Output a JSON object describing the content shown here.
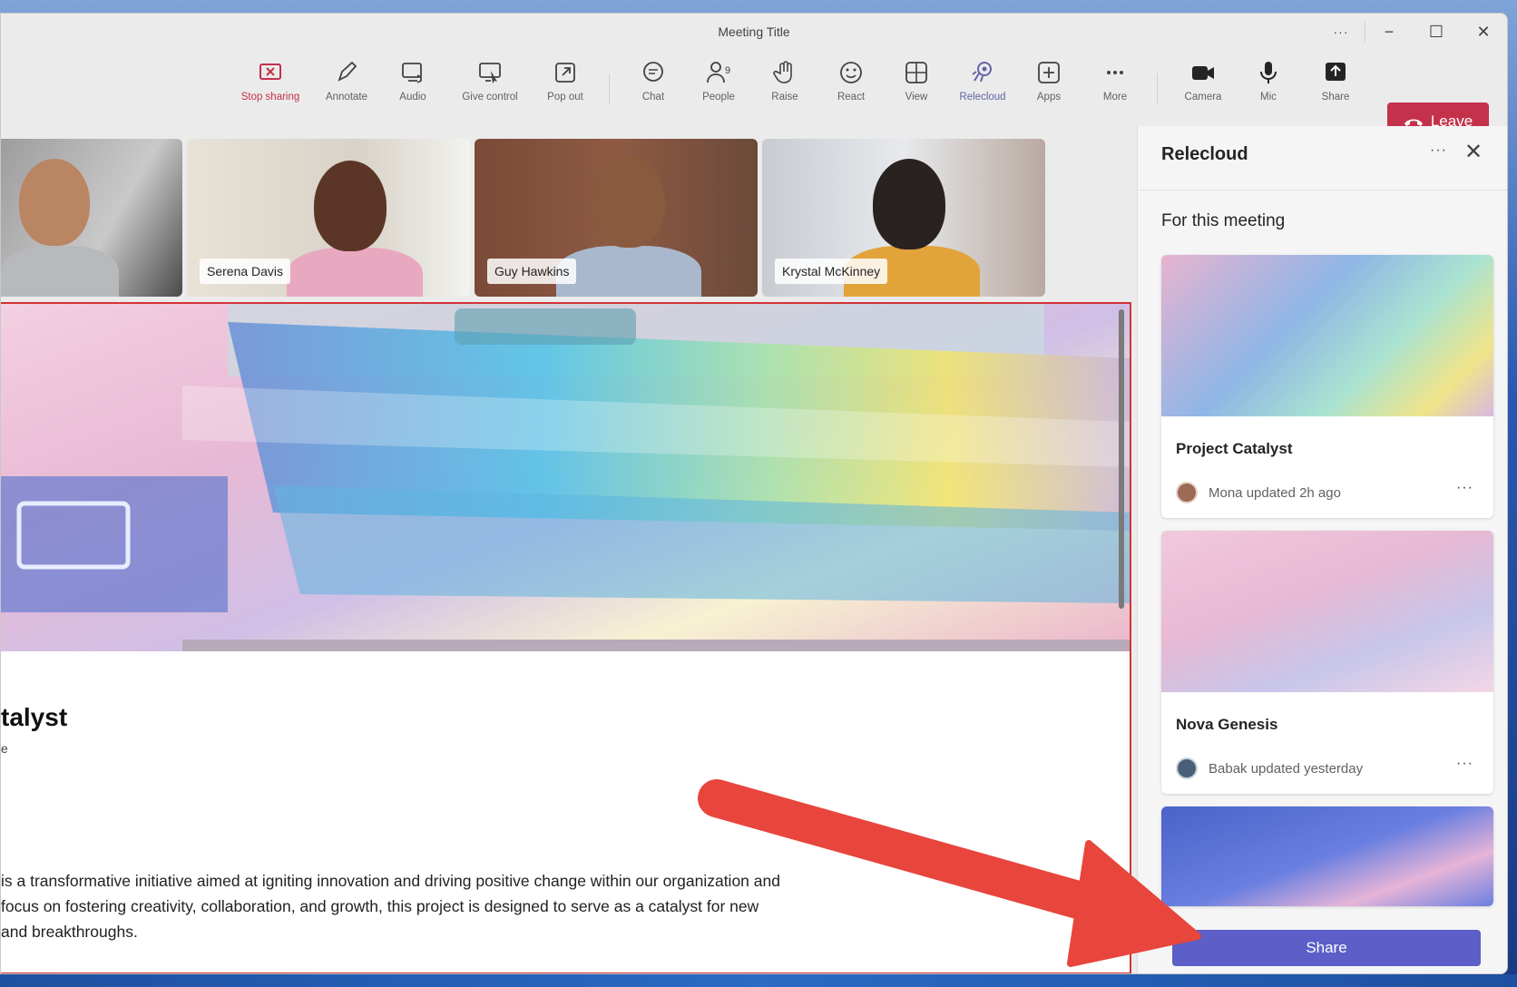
{
  "window": {
    "title": "Meeting Title",
    "more_label": "···",
    "minimize_label": "−",
    "maximize_label": "☐",
    "close_label": "✕"
  },
  "toolbar": {
    "stop_sharing": "Stop sharing",
    "annotate": "Annotate",
    "audio": "Audio",
    "give_control": "Give control",
    "pop_out": "Pop out",
    "chat": "Chat",
    "people": "People",
    "people_count": "9",
    "raise": "Raise",
    "react": "React",
    "view": "View",
    "relecloud": "Relecloud",
    "apps": "Apps",
    "more": "More",
    "camera": "Camera",
    "mic": "Mic",
    "share": "Share",
    "leave": "Leave"
  },
  "participants": [
    {
      "name": ""
    },
    {
      "name": "Serena Davis"
    },
    {
      "name": "Guy Hawkins"
    },
    {
      "name": "Krystal McKinney"
    }
  ],
  "document": {
    "title": "talyst",
    "subtitle": "e",
    "paragraph_lines": [
      "is a transformative initiative aimed at igniting innovation and driving positive change within our organization and",
      "focus on fostering creativity, collaboration, and growth, this project is designed to serve as a catalyst for new",
      " and breakthroughs."
    ]
  },
  "panel": {
    "title": "Relecloud",
    "more_label": "···",
    "close_label": "✕",
    "section": "For this meeting",
    "cards": [
      {
        "title": "Project Catalyst",
        "meta": "Mona updated 2h ago",
        "more": "···"
      },
      {
        "title": "Nova Genesis",
        "meta": "Babak updated yesterday",
        "more": "···"
      }
    ],
    "share_button": "Share"
  },
  "colors": {
    "leave": "#c4314b",
    "share": "#5b5fc7",
    "stop_sharing": "#c4314b",
    "relecloud": "#6264a7",
    "annotation_arrow": "#e8453c"
  }
}
